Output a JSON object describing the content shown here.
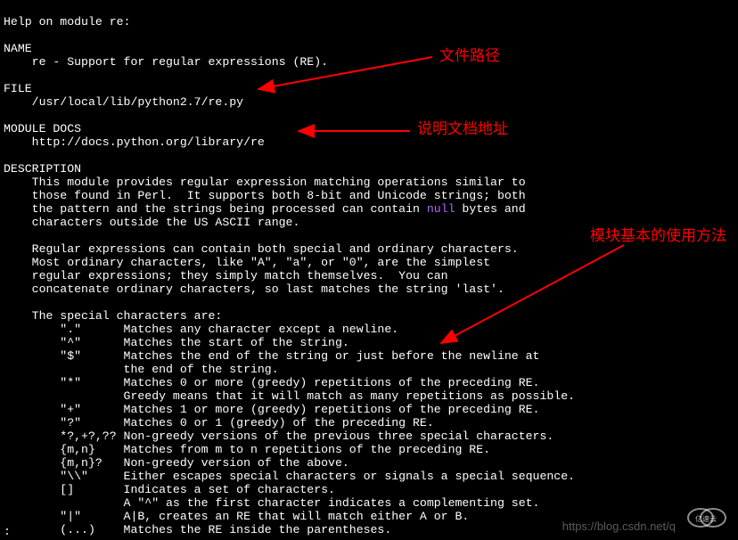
{
  "header": "Help on module re:",
  "sections": {
    "name": {
      "title": "NAME",
      "text": "re - Support for regular expressions (RE)."
    },
    "file": {
      "title": "FILE",
      "text": "/usr/local/lib/python2.7/re.py"
    },
    "docs": {
      "title": "MODULE DOCS",
      "text": "http://docs.python.org/library/re"
    },
    "desc": {
      "title": "DESCRIPTION",
      "para1_l1": "This module provides regular expression matching operations similar to",
      "para1_l2": "those found in Perl.  It supports both 8-bit and Unicode strings; both",
      "para1_l3a": "the pattern and the strings being processed can contain ",
      "para1_l3_null": "null",
      "para1_l3b": " bytes and",
      "para1_l4": "characters outside the US ASCII range.",
      "para2_l1": "Regular expressions can contain both special and ordinary characters.",
      "para2_l2": "Most ordinary characters, like \"A\", \"a\", or \"0\", are the simplest",
      "para2_l3": "regular expressions; they simply match themselves.  You can",
      "para2_l4": "concatenate ordinary characters, so last matches the string 'last'.",
      "specials_header": "The special characters are:",
      "sp_dot_a": "    \".\"      Matches any character except a newline.",
      "sp_caret": "    \"^\"      Matches the start of the string.",
      "sp_dol_a": "    \"$\"      Matches the end of the string or just before the newline at",
      "sp_dol_b": "             the end of the string.",
      "sp_star_a": "    \"*\"      Matches 0 or more (greedy) repetitions of the preceding RE.",
      "sp_star_b": "             Greedy means that it will match as many repetitions as possible.",
      "sp_plus": "    \"+\"      Matches 1 or more (greedy) repetitions of the preceding RE.",
      "sp_qm": "    \"?\"      Matches 0 or 1 (greedy) of the preceding RE.",
      "sp_ng": "    *?,+?,?? Non-greedy versions of the previous three special characters.",
      "sp_mn": "    {m,n}    Matches from m to n repetitions of the preceding RE.",
      "sp_mnq": "    {m,n}?   Non-greedy version of the above.",
      "sp_bs": "    \"\\\\\"     Either escapes special characters or signals a special sequence.",
      "sp_br": "    []       Indicates a set of characters.",
      "sp_br2": "             A \"^\" as the first character indicates a complementing set.",
      "sp_pipe": "    \"|\"      A|B, creates an RE that will match either A or B.",
      "sp_par": "    (...)    Matches the RE inside the parentheses."
    }
  },
  "annotations": {
    "file_path": "文件路径",
    "doc_url": "说明文档地址",
    "usage": "模块基本的使用方法",
    "arrow_color": "#ff0000"
  },
  "watermark": {
    "text": "https://blog.csdn.net/q",
    "logo_label": "亿速云"
  },
  "status": ":"
}
